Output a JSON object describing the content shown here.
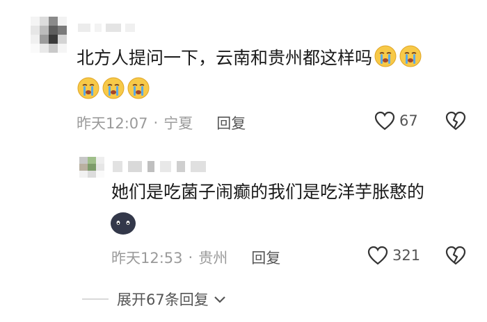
{
  "comment": {
    "text": "北方人提问一下，云南和贵州都这样吗",
    "time": "昨天12:07",
    "location": "宁夏",
    "reply_label": "回复",
    "likes": "67"
  },
  "reply": {
    "text": "她们是吃菌子闹癫的我们是吃洋芋胀憨的",
    "time": "昨天12:53",
    "location": "贵州",
    "reply_label": "回复",
    "likes": "321"
  },
  "expand_label": "展开67条回复",
  "icons": [
    "heart-icon",
    "broken-heart-icon",
    "crying-face-emoji",
    "dark-blob-emoji",
    "chevron-down-icon"
  ],
  "colors": {
    "text": "#1a1a1a",
    "meta": "#9a9a9a",
    "emoji_yellow": "#f7c948",
    "tear_blue": "#5aa9e6"
  }
}
